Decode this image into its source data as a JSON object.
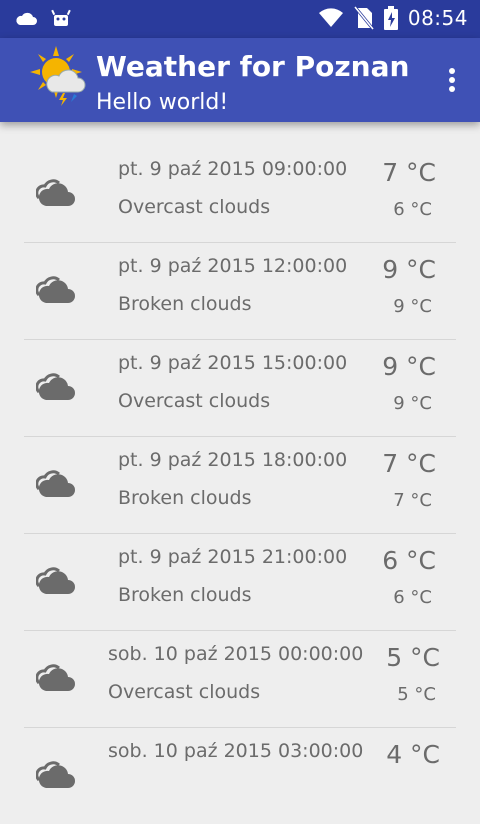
{
  "status_bar": {
    "time": "08:54",
    "icons": [
      "weather-cloud-icon",
      "android-debug-icon",
      "wifi-icon",
      "no-sim-icon",
      "battery-charging-icon"
    ]
  },
  "app_bar": {
    "title": "Weather for Poznan",
    "subtitle": "Hello world!",
    "icon": "sun-cloud-rain-icon",
    "menu_icon": "overflow-menu-icon"
  },
  "forecast": [
    {
      "date": "pt. 9 paź 2015 09:00:00",
      "description": "Overcast clouds",
      "temp": "7 °C",
      "temp_min": "6 °C"
    },
    {
      "date": "pt. 9 paź 2015 12:00:00",
      "description": "Broken clouds",
      "temp": "9 °C",
      "temp_min": "9 °C"
    },
    {
      "date": "pt. 9 paź 2015 15:00:00",
      "description": "Overcast clouds",
      "temp": "9 °C",
      "temp_min": "9 °C"
    },
    {
      "date": "pt. 9 paź 2015 18:00:00",
      "description": "Broken clouds",
      "temp": "7 °C",
      "temp_min": "7 °C"
    },
    {
      "date": "pt. 9 paź 2015 21:00:00",
      "description": "Broken clouds",
      "temp": "6 °C",
      "temp_min": "6 °C"
    },
    {
      "date": "sob. 10 paź 2015 00:00:00",
      "description": "Overcast clouds",
      "temp": "5 °C",
      "temp_min": "5 °C"
    },
    {
      "date": "sob. 10 paź 2015 03:00:00",
      "description": "",
      "temp": "4 °C",
      "temp_min": ""
    }
  ],
  "colors": {
    "status_bar": "#2a3b9c",
    "app_bar": "#3f51b5",
    "background": "#eeeeee",
    "text": "#6b6b6b"
  }
}
